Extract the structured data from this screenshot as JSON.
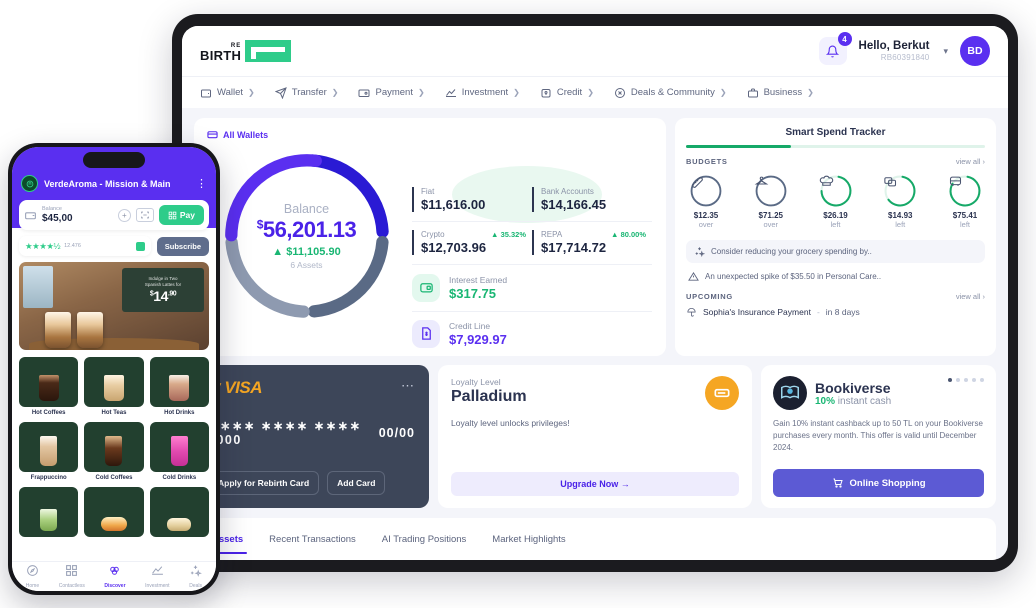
{
  "tablet": {
    "brand": {
      "top": "RE",
      "bottom": "BIRTH",
      "mark": "rebirth-logo-mark"
    },
    "notifications": {
      "count": "4",
      "icon": "bell-icon"
    },
    "user": {
      "greeting": "Hello, Berkut",
      "id": "RB60391840",
      "initials": "BD"
    },
    "nav": [
      {
        "label": "Wallet",
        "icon": "wallet-icon"
      },
      {
        "label": "Transfer",
        "icon": "paper-plane-icon"
      },
      {
        "label": "Payment",
        "icon": "payment-card-icon"
      },
      {
        "label": "Investment",
        "icon": "chart-icon"
      },
      {
        "label": "Credit",
        "icon": "credit-lock-icon"
      },
      {
        "label": "Deals & Community",
        "icon": "deals-icon"
      },
      {
        "label": "Business",
        "icon": "briefcase-icon"
      }
    ],
    "balance": {
      "all_wallets": "All Wallets",
      "label": "Balance",
      "currency": "$",
      "amount": "56,201.13",
      "change": "$11,105.90",
      "change_dir": "up",
      "assets": "6 Assets",
      "stats": [
        {
          "label": "Fiat",
          "value": "$11,616.00",
          "pct": ""
        },
        {
          "label": "Bank Accounts",
          "value": "$14,166.45",
          "pct": ""
        },
        {
          "label": "Crypto",
          "value": "$12,703.96",
          "pct": "35.32%"
        },
        {
          "label": "REPA",
          "value": "$17,714.72",
          "pct": "80.00%"
        }
      ],
      "rows": [
        {
          "label": "Interest Earned",
          "value": "$317.75",
          "icon": "wallet-green-icon",
          "tone": "green"
        },
        {
          "label": "Credit Line",
          "value": "$7,929.97",
          "icon": "document-dollar-icon",
          "tone": "purple"
        }
      ]
    },
    "spend": {
      "title": "Smart Spend Tracker",
      "budgets_label": "BUDGETS",
      "view_all": "view all",
      "budgets": [
        {
          "icon": "baguette-icon",
          "amount": "$12.35",
          "status": "over",
          "pct": 100,
          "color": "#5c6party"
        },
        {
          "icon": "hanger-icon",
          "amount": "$71.25",
          "status": "over",
          "pct": 100,
          "color": "#4a5570"
        },
        {
          "icon": "chef-hat-icon",
          "amount": "$26.19",
          "status": "left",
          "pct": 72,
          "color": "#16a968"
        },
        {
          "icon": "tickets-icon",
          "amount": "$14.93",
          "status": "left",
          "pct": 62,
          "color": "#16a968"
        },
        {
          "icon": "bus-icon",
          "amount": "$75.41",
          "status": "left",
          "pct": 80,
          "color": "#16a968"
        }
      ],
      "tip": "Consider reducing your grocery spending by..",
      "alert": "An unexpected spike of $35.50 in Personal Care..",
      "upcoming_label": "UPCOMING",
      "upcoming_view_all": "view all",
      "upcoming_item": "Sophia's Insurance Payment",
      "upcoming_sep": "-",
      "upcoming_when": "in 8 days"
    },
    "visa": {
      "brand": "VISA",
      "masked": "∗∗∗∗ ∗∗∗∗ ∗∗∗∗ 0000",
      "expiry": "00/00",
      "apply_label": "Apply for Rebirth Card",
      "add_label": "Add Card",
      "more_icon": "more-dots-icon"
    },
    "loyalty": {
      "label": "Loyalty Level",
      "level": "Palladium",
      "sub": "Loyalty level unlocks privileges!",
      "cta": "Upgrade Now",
      "cta_arrow": "→",
      "coin_icon": "loyalty-coin-icon"
    },
    "offer": {
      "name": "Bookiverse",
      "cashback_pct": "10%",
      "cashback_rest": " instant cash",
      "desc": "Gain 10% instant cashback up to 50 TL on your Bookiverse purchases every month. This offer is valid until December 2024.",
      "cta": "Online Shopping",
      "cta_icon": "shopping-cart-icon",
      "dots": 5,
      "active_dot": 0
    },
    "tabs": [
      {
        "label": "Assets",
        "active": true
      },
      {
        "label": "Recent Transactions",
        "active": false
      },
      {
        "label": "AI Trading Positions",
        "active": false
      },
      {
        "label": "Market Highlights",
        "active": false
      }
    ]
  },
  "phone": {
    "header": {
      "title": "VerdeAroma - Mission & Main",
      "shop_icon": "coffee-shop-icon",
      "menu_icon": "kebab-menu-icon"
    },
    "balance": {
      "label": "Balance",
      "value": "$45,00",
      "plus_icon": "plus-circle-icon",
      "scan_icon": "scan-icon",
      "pay_label": "Pay",
      "pay_icon": "qr-icon"
    },
    "rating": {
      "stars": "★★★★½",
      "count": "12.476",
      "chip_icon": "gift-chip-icon",
      "subscribe_label": "Subscribe"
    },
    "promo": {
      "line1": "Indulge in Two",
      "line2": "Spanish Lattes for",
      "price": "14",
      "cents": ".90",
      "currency": "$"
    },
    "categories": [
      {
        "label": "Hot Coffees",
        "icon": "hot-coffee-mug"
      },
      {
        "label": "Hot Teas",
        "icon": "hot-tea-mug"
      },
      {
        "label": "Hot Drinks",
        "icon": "hot-chocolate-mug"
      },
      {
        "label": "Frappuccino",
        "icon": "frappuccino-cup"
      },
      {
        "label": "Cold Coffees",
        "icon": "cold-coffee-glass"
      },
      {
        "label": "Cold Drinks",
        "icon": "cold-drink-cup"
      },
      {
        "label": "",
        "icon": "matcha-cup"
      },
      {
        "label": "",
        "icon": "food-plate"
      },
      {
        "label": "",
        "icon": "bakery-item"
      }
    ],
    "nav": [
      {
        "label": "Home",
        "icon": "home-icon",
        "active": false
      },
      {
        "label": "Contactless",
        "icon": "qr-code-icon",
        "active": false
      },
      {
        "label": "Discover",
        "icon": "discover-icon",
        "active": true
      },
      {
        "label": "Investment",
        "icon": "investment-icon",
        "active": false
      },
      {
        "label": "Deals",
        "icon": "deals-sparkle-icon",
        "active": false
      }
    ]
  },
  "colors": {
    "brand_purple": "#5a2ff0",
    "brand_green": "#2ecc8a",
    "donut": [
      "#2a1ad4",
      "#5a6a85",
      "#8e9ab0",
      "#5a2ff0"
    ],
    "dark_slate": "#3d4659"
  }
}
